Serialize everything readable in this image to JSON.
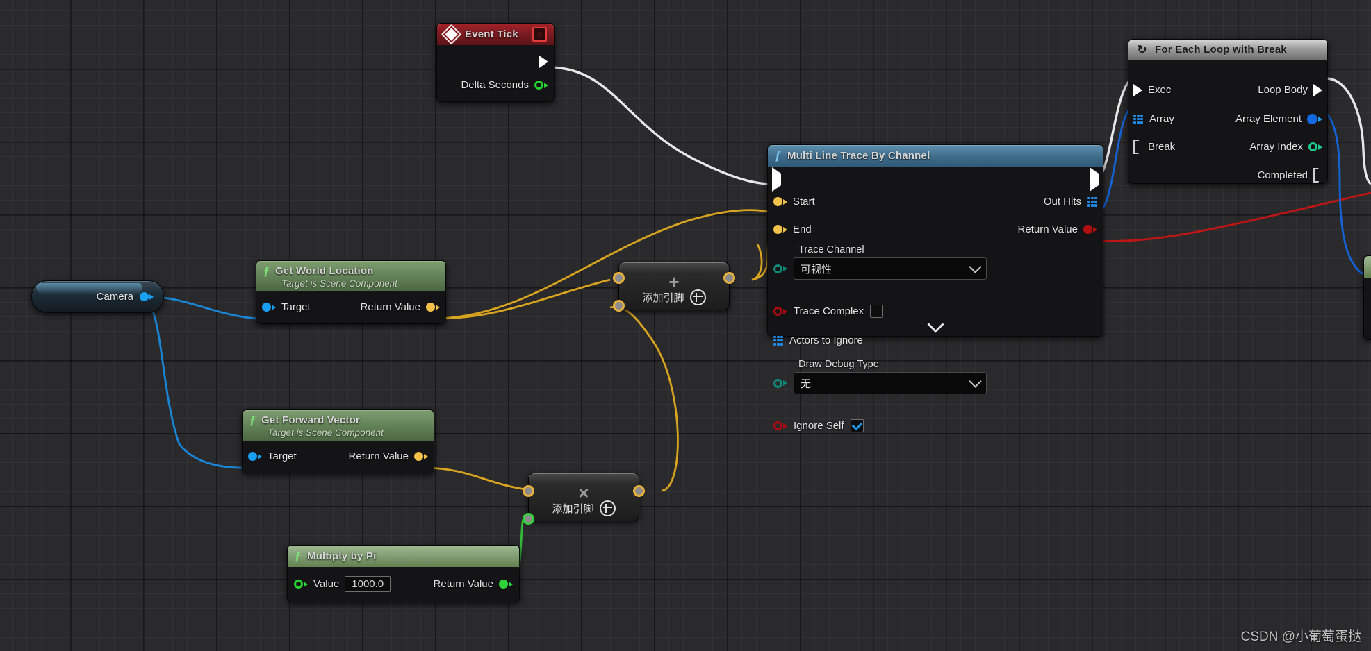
{
  "watermark": "CSDN @小葡萄蛋挞",
  "nodes": {
    "event_tick": {
      "title": "Event Tick",
      "icon": "event-diamond-icon",
      "breakpoint_icon": "stop-square-icon",
      "outputs": [
        {
          "label": "",
          "type": "exec"
        },
        {
          "label": "Delta Seconds",
          "type": "float"
        }
      ]
    },
    "get_world_location": {
      "title": "Get World Location",
      "subtitle": "Target is Scene Component",
      "icon": "function-f-icon",
      "inputs": [
        {
          "label": "Target",
          "type": "object"
        }
      ],
      "outputs": [
        {
          "label": "Return Value",
          "type": "vector"
        }
      ]
    },
    "get_forward_vector": {
      "title": "Get Forward Vector",
      "subtitle": "Target is Scene Component",
      "icon": "function-f-icon",
      "inputs": [
        {
          "label": "Target",
          "type": "object"
        }
      ],
      "outputs": [
        {
          "label": "Return Value",
          "type": "vector"
        }
      ]
    },
    "multiply_by_pi": {
      "title": "Multiply by Pi",
      "icon": "function-f-icon",
      "inputs": [
        {
          "label": "Value",
          "type": "float",
          "value": "1000.0"
        }
      ],
      "outputs": [
        {
          "label": "Return Value",
          "type": "float"
        }
      ]
    },
    "camera": {
      "label": "Camera",
      "type": "object"
    },
    "add_node": {
      "operator": "+",
      "add_pin_label": "添加引脚",
      "add_pin_icon": "plus-circle-icon"
    },
    "multiply_node": {
      "operator": "×",
      "add_pin_label": "添加引脚",
      "add_pin_icon": "plus-circle-icon"
    },
    "multi_line_trace": {
      "title": "Multi Line Trace By Channel",
      "icon": "function-f-icon",
      "inputs": [
        {
          "label": "Start",
          "type": "vector"
        },
        {
          "label": "End",
          "type": "vector"
        }
      ],
      "outputs": [
        {
          "label": "Out Hits",
          "type": "array"
        },
        {
          "label": "Return Value",
          "type": "bool"
        }
      ],
      "trace_channel": {
        "label": "Trace Channel",
        "value": "可视性"
      },
      "trace_complex": {
        "label": "Trace Complex",
        "checked": false
      },
      "actors_to_ignore": {
        "label": "Actors to Ignore"
      },
      "draw_debug_type": {
        "label": "Draw Debug Type",
        "value": "无"
      },
      "ignore_self": {
        "label": "Ignore Self",
        "checked": true
      },
      "collapse_icon": "chevron-down-icon"
    },
    "for_each_loop": {
      "title": "For Each Loop with Break",
      "icon": "loop-macro-icon",
      "inputs": [
        {
          "label": "Exec",
          "type": "exec"
        },
        {
          "label": "Array",
          "type": "array"
        },
        {
          "label": "Break",
          "type": "exec"
        }
      ],
      "outputs": [
        {
          "label": "Loop Body",
          "type": "exec"
        },
        {
          "label": "Array Element",
          "type": "object"
        },
        {
          "label": "Array Index",
          "type": "int"
        },
        {
          "label": "Completed",
          "type": "exec"
        }
      ]
    }
  },
  "colors": {
    "exec": "#ffffff",
    "vector": "#f2c14a",
    "object": "#1a9ef0",
    "float": "#2fd43a",
    "bool": "#b01010",
    "enum": "#0e8a79",
    "array": "#1f8ae8",
    "wire_exec": "#e8e8e8",
    "wire_vector": "#d9a520",
    "wire_object": "#1a86d8",
    "wire_float": "#35b83a",
    "wire_bool": "#c01515",
    "wire_array": "#1464d8"
  }
}
